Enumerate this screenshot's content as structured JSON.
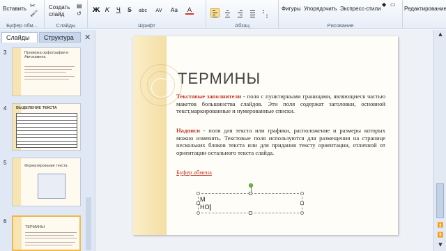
{
  "ribbon": {
    "clipboard": {
      "paste_label": "Вставить",
      "group_label": "Буфер обм..."
    },
    "slides": {
      "new_slide_label": "Создать\nслайд",
      "group_label": "Слайды"
    },
    "font": {
      "group_label": "Шрифт",
      "bold": "Ж",
      "italic": "К",
      "underline": "Ч",
      "strike": "S",
      "shadow": "abc",
      "spacing": "AV",
      "case": "Aa",
      "color": "A"
    },
    "paragraph": {
      "group_label": "Абзац"
    },
    "drawing": {
      "shapes_label": "Фигуры",
      "arrange_label": "Упорядочить",
      "quick_styles_label": "Экспресс-стили",
      "group_label": "Рисование"
    },
    "editing": {
      "label": "Редактирование"
    }
  },
  "panel": {
    "tabs": [
      "Слайды",
      "Структура"
    ],
    "close": "✕",
    "thumbnails": [
      {
        "number": "3",
        "title": "Проверка орфографии и Автозамена"
      },
      {
        "number": "4",
        "title": "ВЫДЕЛЕНИЕ ТЕКСТА"
      },
      {
        "number": "5",
        "title": "Форматирование текста"
      },
      {
        "number": "6",
        "title": "ТЕРМИНЫ"
      }
    ]
  },
  "slide": {
    "title": "ТЕРМИНЫ",
    "para1_term": "Текстовые заполнители",
    "para1_text": " - поля с пунктирными границами, являющиеся частью макетов большинства слайдов. Эти поля содержат заголовки, основной текст,маркированные и нумерованные списки.",
    "para2_term": "Надписи",
    "para2_text": " - поля для текста или графики, расположение и размеры которых можно изменять. Текстовые поля используются для размещения на странице нескольких блоков текста или для придания тексту ориентации, отличной от ориентации остального текста слайда.",
    "link": "Буфер обмена",
    "textbox_line1": "М",
    "textbox_line2": "НО"
  },
  "colors": {
    "accent": "#c0392b",
    "ribbon": "#e6edf7",
    "selected_thumb": "#f0b84c"
  }
}
